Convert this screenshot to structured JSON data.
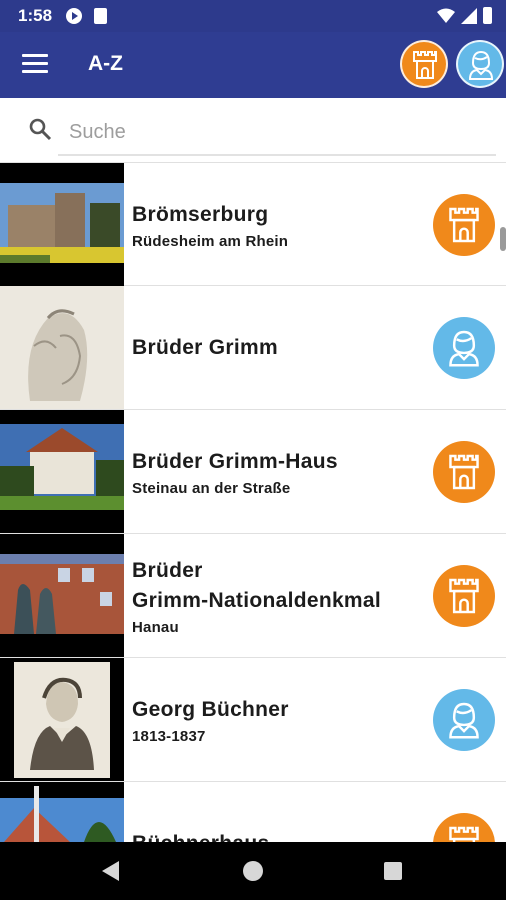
{
  "status_bar": {
    "time": "1:58"
  },
  "app_bar": {
    "menu_icon": "hamburger-menu-icon",
    "title": "A-Z",
    "filter_badges": [
      {
        "icon": "castle-icon",
        "color": "#f0891b"
      },
      {
        "icon": "person-icon",
        "color": "#63b9e8"
      }
    ]
  },
  "search": {
    "placeholder": "Suche",
    "value": ""
  },
  "colors": {
    "primary": "#2f3d92",
    "castle": "#f0891b",
    "person": "#63b9e8"
  },
  "items": [
    {
      "title": "Brömserburg",
      "subtitle": "Rüdesheim am Rhein",
      "category_icon": "castle-icon"
    },
    {
      "title": "Brüder Grimm",
      "subtitle": "",
      "category_icon": "person-icon"
    },
    {
      "title": "Brüder Grimm-Haus",
      "subtitle": "Steinau an der Straße",
      "category_icon": "castle-icon"
    },
    {
      "title_line1": "Brüder",
      "title_line2": "Grimm-Nationaldenkmal",
      "subtitle": "Hanau",
      "category_icon": "castle-icon"
    },
    {
      "title": "Georg Büchner",
      "subtitle": "1813-1837",
      "category_icon": "person-icon"
    },
    {
      "title": "Büchnerhaus",
      "subtitle": "",
      "category_icon": "castle-icon"
    }
  ],
  "nav_bar": {
    "icons": [
      "back-icon",
      "home-icon",
      "recents-icon"
    ]
  }
}
